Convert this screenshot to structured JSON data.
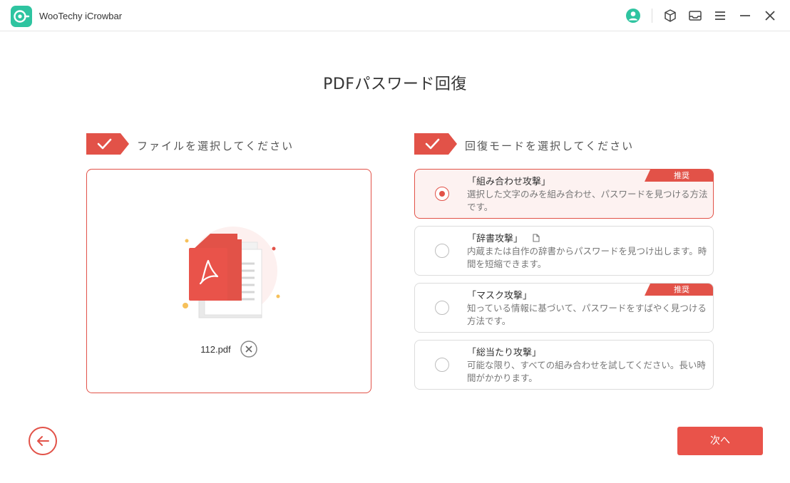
{
  "app": {
    "name": "WooTechy iCrowbar"
  },
  "page": {
    "title": "PDFパスワード回復"
  },
  "file_section": {
    "label": "ファイルを選択してください",
    "file_name": "112.pdf"
  },
  "mode_section": {
    "label": "回復モードを選択してください",
    "options": [
      {
        "title": "「組み合わせ攻撃」",
        "desc": "選択した文字のみを組み合わせ、パスワードを見つける方法です。",
        "badge": "推奨",
        "selected": true
      },
      {
        "title": "「辞書攻撃」",
        "desc": "内蔵または自作の辞書からパスワードを見つけ出します。時間を短縮できます。",
        "badge": "",
        "selected": false
      },
      {
        "title": "「マスク攻撃」",
        "desc": "知っている情報に基づいて、パスワードをすばやく見つける方法です。",
        "badge": "推奨",
        "selected": false
      },
      {
        "title": "「総当たり攻撃」",
        "desc": "可能な限り、すべての組み合わせを試してください。長い時間がかかります。",
        "badge": "",
        "selected": false
      }
    ]
  },
  "buttons": {
    "next": "次へ"
  },
  "colors": {
    "accent": "#e25248",
    "logo": "#2ec4a0",
    "selected_bg": "#fdf2f1"
  },
  "icons": {
    "account": "user-circle-icon",
    "package": "cube-icon",
    "mail": "envelope-icon",
    "menu": "hamburger-icon",
    "minimize": "minimize-icon",
    "close": "close-icon"
  }
}
